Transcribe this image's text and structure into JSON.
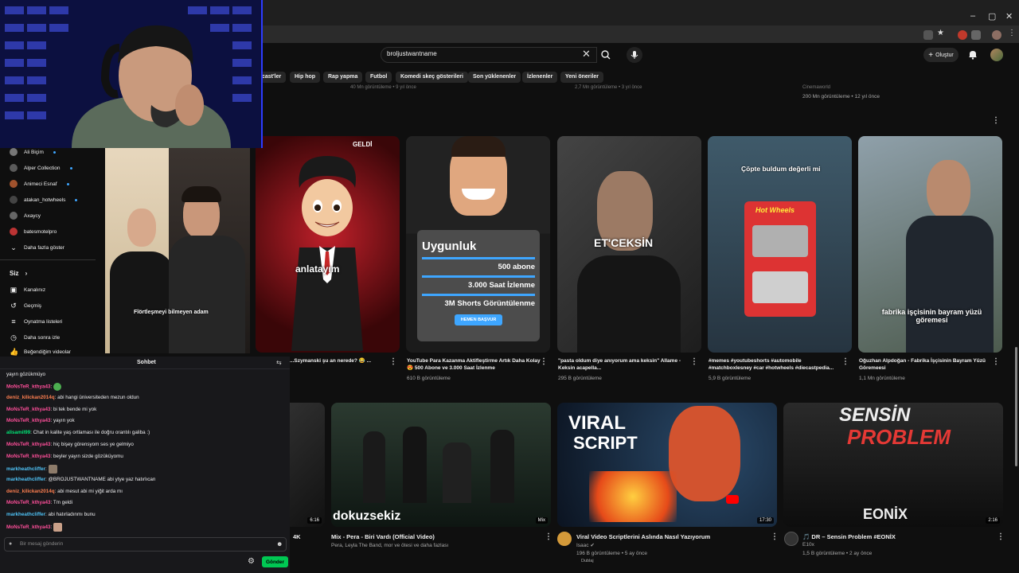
{
  "window": {
    "minimize": "–",
    "maximize": "▢",
    "close": "✕"
  },
  "search": {
    "query": "broljustwantname"
  },
  "header": {
    "create_label": "Oluştur"
  },
  "chips": [
    "cast'ler",
    "Hip hop",
    "Rap yapma",
    "Futbol",
    "Komedi skeç gösterileri",
    "Son yüklenenler",
    "İzlenenler",
    "Yeni öneriler"
  ],
  "top_row": [
    {
      "meta": "40 Mn görüntüleme • 9 yıl önce"
    },
    {
      "meta": "2,7 Mn görüntüleme • 3 yıl önce"
    },
    {
      "channel": "Cinemaworld",
      "meta": "200 Mn görüntüleme • 12 yıl önce"
    }
  ],
  "shorts": [
    {
      "title": "...Szymanski şu an nerede? 😂 ...",
      "views": "",
      "overlay": "anlatayım",
      "badge": "GELDİ"
    },
    {
      "title": "YouTube Para Kazanma Aktifleştirme Artık Daha Kolay 😍 500 Abone ve 3.000 Saat İzlenme",
      "views": "610 B görüntüleme",
      "card": {
        "heading": "Uygunluk",
        "line1": "500 abone",
        "line2": "3.000 Saat İzlenme",
        "line3": "3M Shorts Görüntülenme",
        "button": "HEMEN BAŞVUR"
      }
    },
    {
      "title": "\"pasta oldum diye anıyorum ama keksin\" Allame - Keksin acapella...",
      "views": "295 B görüntüleme",
      "overlay": "ET'CEKSİN"
    },
    {
      "title": "#memes #youtubeshorts #automobile #matchboxlesney #car #hotwheels #diecastpedia...",
      "views": "5,9 B görüntüleme",
      "overlay": "Çöpte buldum değerli mi",
      "brand": "Hot Wheels"
    },
    {
      "title": "Oğuzhan Alpdoğan - Fabrika İşçisinin Bayram Yüzü Göremeesi",
      "views": "1,1 Mn görüntüleme",
      "overlay": "fabrika işçisinin bayram yüzü göremesi"
    }
  ],
  "videos": [
    {
      "title": "4K",
      "meta": "",
      "duration": "6:16"
    },
    {
      "title": "Mix - Pera - Biri Vardı (Official Video)",
      "meta": "Pera, Leyla The Band, mor ve ötesi ve daha fazlası",
      "duration": "Mix",
      "overlay": "dokuzsekiz"
    },
    {
      "title": "Viral Video Scriptlerini Aslında Nasıl Yazıyorum",
      "channel": "Isaac ✔",
      "meta": "196 B görüntüleme • 5 ay önce",
      "duration": "17:30",
      "overlay1": "VIRAL",
      "overlay2": "SCRIPT",
      "extra": "Dublaj"
    },
    {
      "title": "🎵 DR – Sensin Problem #EONİX",
      "channel": "E10x",
      "meta": "1,5 B görüntüleme • 2 ay önce",
      "duration": "2:16",
      "overlay1": "SENSİN",
      "overlay2": "PROBLEM",
      "overlay3": "EONİX"
    }
  ],
  "sidebar": {
    "subs": [
      "Ali Biçim",
      "Alper Collection",
      "Animeci Esnaf",
      "atakan_hotwheels",
      "Axaycy",
      "batesmotelpro"
    ],
    "more": "Daha fazla göster",
    "you_heading": "Siz",
    "you_items": [
      "Kanalınız",
      "Geçmiş",
      "Oynatma listeleri",
      "Daha sonra izle",
      "Beğendiğim videolar"
    ]
  },
  "phone": {
    "caption": "Flörtleşmeyi bilmeyen adam"
  },
  "chat": {
    "title": "Sohbet",
    "messages": [
      {
        "user": "",
        "text": "yayın gözükmüyo",
        "color": "#efeff1"
      },
      {
        "user": "MoNsTeR_kthya43",
        "text": "",
        "color": "#ff4f9a"
      },
      {
        "user": "deniz_kilickan2014q",
        "text": "abi hangi üniversiteden mezun oldun",
        "color": "#ff7f50"
      },
      {
        "user": "MoNsTeR_kthya43",
        "text": "bi tek bende mi yok",
        "color": "#ff4f9a"
      },
      {
        "user": "MoNsTeR_kthya43",
        "text": "yayın yok",
        "color": "#ff4f9a"
      },
      {
        "user": "alisamil99",
        "text": "Chat in kalite yaş ortlaması ile doğru orantılı galiba :)",
        "color": "#00e676"
      },
      {
        "user": "MoNsTeR_kthya43",
        "text": "hiç bişey görensyom ses ye gelmiyo",
        "color": "#ff4f9a"
      },
      {
        "user": "MoNsTeR_kthya43",
        "text": "beyler yayın sizde gözüküyomu",
        "color": "#ff4f9a"
      },
      {
        "user": "markheathcliffer",
        "text": "",
        "color": "#4fc3f7"
      },
      {
        "user": "markheathcliffer",
        "text": "@BROJUSTWANTNAME abi ytye yaz hatırlıcan",
        "color": "#4fc3f7"
      },
      {
        "user": "deniz_kilickan2014q",
        "text": "abi mesut abi mi yiğit arda mı",
        "color": "#ff7f50"
      },
      {
        "user": "MoNsTeR_kthya43",
        "text": "Tm geldi",
        "color": "#ff4f9a"
      },
      {
        "user": "markheathcliffer",
        "text": "abi hatırladınmı bunu",
        "color": "#4fc3f7"
      },
      {
        "user": "MoNsTeR_kthya43",
        "text": "",
        "color": "#ff4f9a"
      }
    ],
    "placeholder": "Bir mesaj gönderin",
    "send_label": "Gönder"
  }
}
